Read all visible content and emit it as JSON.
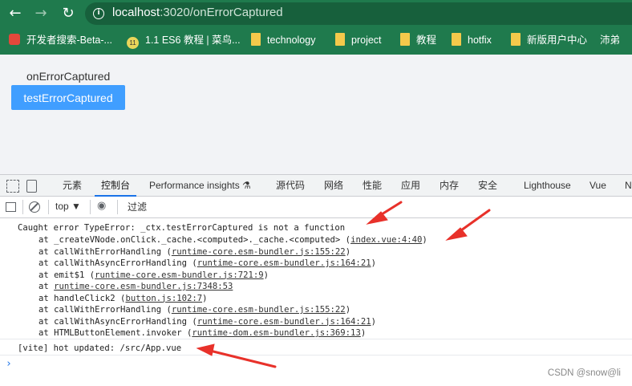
{
  "browser": {
    "url_host": "localhost",
    "url_path": ":3020/onErrorCaptured",
    "bookmarks": [
      {
        "label": "开发者搜索-Beta-...",
        "icon": "paw-icon"
      },
      {
        "label": "1.1 ES6 教程 | 菜鸟...",
        "icon": "globe-icon"
      },
      {
        "label": "technology",
        "icon": "folder-icon"
      },
      {
        "label": "project",
        "icon": "folder-icon"
      },
      {
        "label": "教程",
        "icon": "folder-icon"
      },
      {
        "label": "hotfix",
        "icon": "folder-icon"
      },
      {
        "label": "新版用户中心",
        "icon": "folder-icon"
      },
      {
        "label": "沛弟",
        "icon": "page-icon"
      }
    ],
    "nums_badge": "11"
  },
  "page": {
    "component_title": "onErrorCaptured",
    "button_label": "testErrorCaptured",
    "button_color": "#409eff"
  },
  "devtools": {
    "tabs": [
      "元素",
      "控制台",
      "Performance insights ⚗",
      "源代码",
      "网络",
      "性能",
      "应用",
      "内存",
      "安全",
      "Lighthouse",
      "Vue",
      "N"
    ],
    "active_tab": "控制台",
    "context": "top ▼",
    "filter_placeholder": "过滤",
    "accent": "#1a73e8"
  },
  "console": {
    "error_header": "Caught error TypeError: _ctx.testErrorCaptured is not a function",
    "stack": [
      {
        "prefix": "at _createVNode.onClick._cache.<computed>._cache.<computed> (",
        "link": "index.vue:4:40",
        "suffix": ")"
      },
      {
        "prefix": "at callWithErrorHandling (",
        "link": "runtime-core.esm-bundler.js:155:22",
        "suffix": ")"
      },
      {
        "prefix": "at callWithAsyncErrorHandling (",
        "link": "runtime-core.esm-bundler.js:164:21",
        "suffix": ")"
      },
      {
        "prefix": "at emit$1 (",
        "link": "runtime-core.esm-bundler.js:721:9",
        "suffix": ")"
      },
      {
        "prefix": "at ",
        "link": "runtime-core.esm-bundler.js:7348:53",
        "suffix": ""
      },
      {
        "prefix": "at handleClick2 (",
        "link": "button.js:102:7",
        "suffix": ")"
      },
      {
        "prefix": "at callWithErrorHandling (",
        "link": "runtime-core.esm-bundler.js:155:22",
        "suffix": ")"
      },
      {
        "prefix": "at callWithAsyncErrorHandling (",
        "link": "runtime-core.esm-bundler.js:164:21",
        "suffix": ")"
      },
      {
        "prefix": "at HTMLButtonElement.invoker (",
        "link": "runtime-dom.esm-bundler.js:369:13",
        "suffix": ")"
      }
    ],
    "vite_message": "[vite] hot updated: /src/App.vue",
    "prompt": "›"
  },
  "watermark": "CSDN @snow@li",
  "annotation_color": "#e8312a"
}
